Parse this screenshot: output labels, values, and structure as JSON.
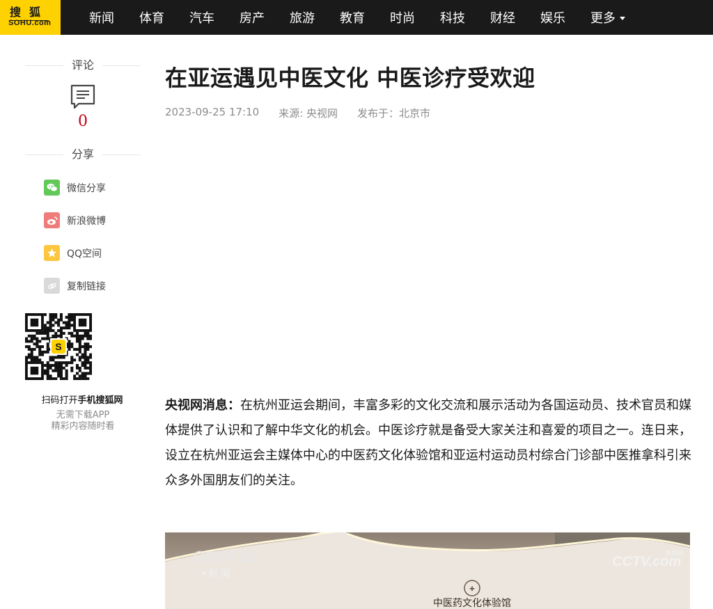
{
  "topnav": {
    "logo_line1": "搜狐",
    "logo_line2": "SOHU.com",
    "items": [
      "新闻",
      "体育",
      "汽车",
      "房产",
      "旅游",
      "教育",
      "时尚",
      "科技",
      "财经",
      "娱乐"
    ],
    "more_label": "更多"
  },
  "sidebar": {
    "comment_heading": "评论",
    "comment_count": "0",
    "share_heading": "分享",
    "share_items": [
      {
        "label": "微信分享",
        "icon": "wechat-icon",
        "color": "#62c85a"
      },
      {
        "label": "新浪微博",
        "icon": "weibo-icon",
        "color": "#f07b7b"
      },
      {
        "label": "QQ空间",
        "icon": "qzone-icon",
        "color": "#fcc73e"
      },
      {
        "label": "复制链接",
        "icon": "link-icon",
        "color": "#d9d9d9"
      }
    ],
    "qr_caption_prefix": "扫码打开",
    "qr_caption_bold": "手机搜狐网",
    "qr_sub1": "无需下载APP",
    "qr_sub2": "精彩内容随时看"
  },
  "article": {
    "title": "在亚运遇见中医文化 中医诊疗受欢迎",
    "date": "2023-09-25 17:10",
    "source": "来源: 央视网",
    "publish_place": "发布于：北京市",
    "lead_bold": "央视网消息：",
    "body": "在杭州亚运会期间，丰富多彩的文化交流和展示活动为各国运动员、技术官员和媒体提供了认识和了解中华文化的机会。中医诊疗就是备受大家关注和喜爱的项目之一。连日来，设立在杭州亚运会主媒体中心的中医药文化体验馆和亚运村运动员村综合门诊部中医推拿科引来众多外国朋友们的关注。"
  },
  "video": {
    "channel_logo": "CCTV 13",
    "channel_sub": "新 闻",
    "watermark": "CCTV.com",
    "watermark_sub": "央视网",
    "sign_text": "中医药文化体验馆"
  },
  "colors": {
    "nav_bg": "#1a1a1a",
    "logo_bg": "#fed100",
    "comment_count": "#c5000f"
  }
}
